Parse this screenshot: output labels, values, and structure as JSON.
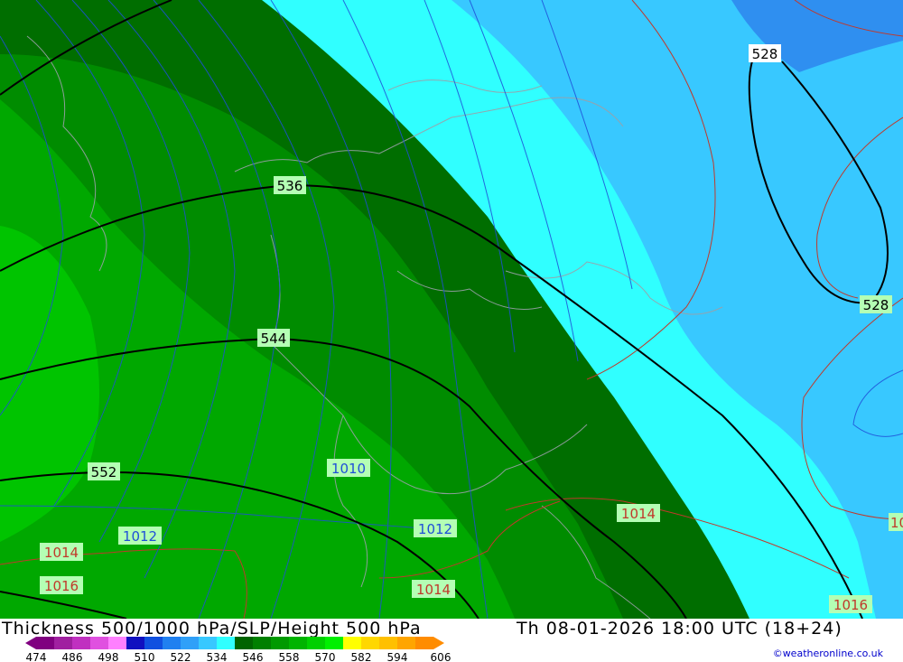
{
  "title": "Thickness 500/1000 hPa/SLP/Height 500 hPa",
  "datetime": "Th 08-01-2026 18:00 UTC (18+24)",
  "credit": "©weatheronline.co.uk",
  "legend": {
    "colors": [
      "#800080",
      "#a020a0",
      "#c030c0",
      "#e050e0",
      "#ff80ff",
      "#1010c0",
      "#1050e0",
      "#2080f0",
      "#30a0f8",
      "#38c8ff",
      "#30ffff",
      "#006400",
      "#008000",
      "#009a00",
      "#00b400",
      "#00d000",
      "#00f000",
      "#ffff00",
      "#ffd700",
      "#ffc000",
      "#ffa500",
      "#ff8c00"
    ],
    "ticks": [
      "474",
      "486",
      "498",
      "510",
      "522",
      "534",
      "546",
      "558",
      "570",
      "582",
      "594",
      "606"
    ]
  },
  "thickness_labels": [
    "528",
    "528",
    "536",
    "544",
    "552"
  ],
  "pressure_labels": [
    "1010",
    "1012",
    "1012",
    "1014",
    "1014",
    "1014",
    "1016",
    "1016",
    "1016",
    "10"
  ]
}
